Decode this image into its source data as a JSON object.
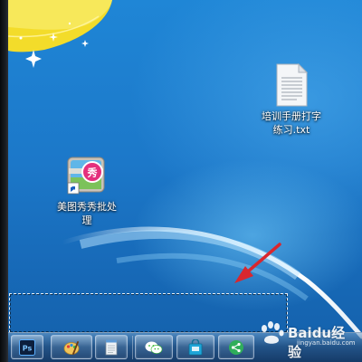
{
  "desktop": {
    "icons": [
      {
        "label_line1": "培训手册打字",
        "label_line2": "练习.txt",
        "icon": "text-file-icon"
      },
      {
        "label_line1": "美图秀秀批处",
        "label_line2": "理",
        "icon": "meitu-batch-icon",
        "badge": "秀"
      }
    ]
  },
  "taskbar": {
    "buttons": [
      {
        "icon": "photoshop-icon",
        "text": "Ps"
      },
      {
        "icon": "paint-icon"
      },
      {
        "icon": "notepad-icon"
      },
      {
        "icon": "wechat-icon"
      },
      {
        "icon": "store-bag-icon"
      },
      {
        "icon": "share-icon"
      }
    ]
  },
  "watermark": {
    "text": "Baidu经验",
    "sub": "jingyan.baidu.com"
  },
  "colors": {
    "wallpaper": "#1c78c9",
    "arrow": "#d9272e",
    "flower": "#f3dc2a"
  }
}
